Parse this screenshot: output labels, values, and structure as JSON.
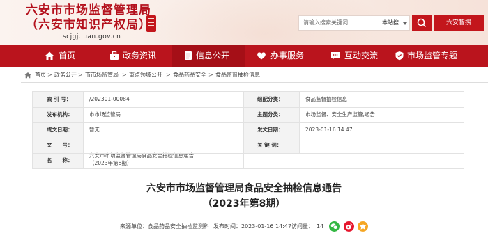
{
  "header": {
    "title_line1": "六安市市场监督管理局",
    "title_line2": "（六安市知识产权局）",
    "domain": "scjgj.luan.gov.cn",
    "search_placeholder": "请输入搜索关键词",
    "search_scope": "本站搜",
    "service_button": "六安智搜"
  },
  "nav": {
    "items": [
      {
        "label": "首页",
        "icon": "home-icon"
      },
      {
        "label": "政务资讯",
        "icon": "briefcase-icon"
      },
      {
        "label": "信息公开",
        "icon": "document-icon"
      },
      {
        "label": "办事服务",
        "icon": "heart-icon"
      },
      {
        "label": "互动交流",
        "icon": "chat-icon"
      },
      {
        "label": "市场监管专题",
        "icon": "badge-icon"
      }
    ],
    "active": "信息公开"
  },
  "breadcrumb": [
    "首页",
    "政务公开",
    "市市场监管局",
    "重点领域公开",
    "食品药品安全",
    "食品监督抽检信息"
  ],
  "info_table": {
    "index_label": "索 引 号：",
    "index_value": "/202301-00084",
    "category_label": "组配分类：",
    "category_value": "食品监督抽检信息",
    "publisher_label": "发布机构：",
    "publisher_value": "市市场监管局",
    "topic_label": "主题分类：",
    "topic_value": "市场监督、安全生产监管,通告",
    "created_label": "成文日期：",
    "created_value": "暂无",
    "published_label": "发文日期：",
    "published_value": "2023-01-16 14:47",
    "docno_label": "文　　号：",
    "docno_value": "",
    "keywords_label": "关 键 词：",
    "keywords_value": "",
    "name_label": "名　　称：",
    "name_value_line1": "六安市市场监督管理局食品安全抽检信息通告",
    "name_value_line2": "（2023年第8期）"
  },
  "document": {
    "title_line1": "六安市市场监督管理局食品安全抽检信息通告",
    "title_line2": "（2023年第8期）"
  },
  "meta": {
    "source": "来源单位：食品药品安全抽检监测科",
    "date": "发布时间：2023-01-16 14:47",
    "views_label": "访问量：",
    "views": "14"
  },
  "colors": {
    "brand_red": "#ba141d",
    "active_red": "#a50f17",
    "wechat_green": "#33b743",
    "weibo_red": "#e6162d",
    "qzone_yellow": "#f5a623"
  }
}
